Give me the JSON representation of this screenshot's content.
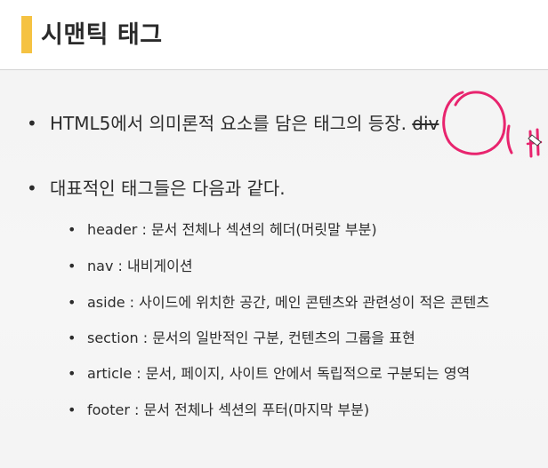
{
  "slide": {
    "title": "시맨틱 태그",
    "bullets": [
      {
        "dot": "•",
        "text": "HTML5에서 의미론적 요소를 담은 태그의 등장.",
        "struck": "div"
      },
      {
        "dot": "•",
        "text": "대표적인 태그들은 다음과 같다."
      }
    ],
    "tags": [
      {
        "dot": "•",
        "name": "header",
        "sep": " : ",
        "desc": "문서 전체나 섹션의 헤더(머릿말 부분)"
      },
      {
        "dot": "•",
        "name": "nav",
        "sep": " : ",
        "desc": "내비게이션"
      },
      {
        "dot": "•",
        "name": "aside",
        "sep": " : ",
        "desc": "사이드에 위치한 공간, 메인 콘텐츠와 관련성이 적은 콘텐츠"
      },
      {
        "dot": "•",
        "name": "section",
        "sep": " : ",
        "desc": "문서의 일반적인 구분, 컨텐츠의 그룹을 표현"
      },
      {
        "dot": "•",
        "name": "article",
        "sep": " : ",
        "desc": "문서, 페이지, 사이트 안에서 독립적으로 구분되는 영역"
      },
      {
        "dot": "•",
        "name": "footer",
        "sep": " : ",
        "desc": "문서 전체나 섹션의 푸터(마지막 부분)"
      }
    ]
  },
  "colors": {
    "accent": "#f5c242",
    "annotation": "#e8246e"
  }
}
